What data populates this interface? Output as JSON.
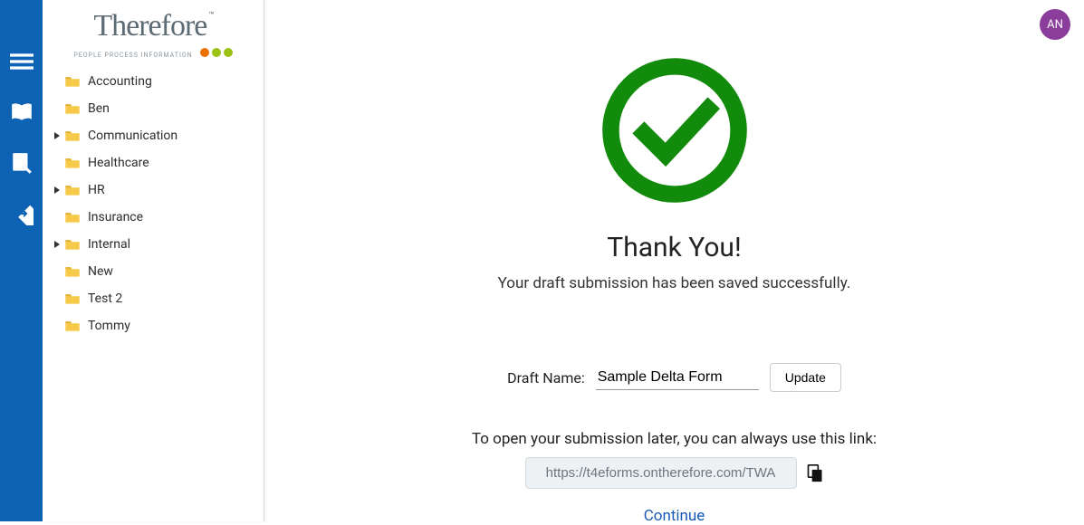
{
  "avatar_initials": "AN",
  "logo": {
    "text": "Therefore",
    "tagline": "PEOPLE  PROCESS  INFORMATION"
  },
  "sidebar": {
    "items": [
      {
        "label": "Accounting",
        "expandable": false
      },
      {
        "label": "Ben",
        "expandable": false
      },
      {
        "label": "Communication",
        "expandable": true
      },
      {
        "label": "Healthcare",
        "expandable": false
      },
      {
        "label": "HR",
        "expandable": true
      },
      {
        "label": "Insurance",
        "expandable": false
      },
      {
        "label": "Internal",
        "expandable": true
      },
      {
        "label": "New",
        "expandable": false
      },
      {
        "label": "Test 2",
        "expandable": false
      },
      {
        "label": "Tommy",
        "expandable": false
      }
    ]
  },
  "main": {
    "title": "Thank You!",
    "subtitle": "Your draft submission has been saved successfully.",
    "draft_label": "Draft Name:",
    "draft_value": "Sample Delta Form",
    "update_label": "Update",
    "link_hint": "To open your submission later, you can always use this link:",
    "link_value": "https://t4eforms.ontherefore.com/TWA",
    "continue_label": "Continue"
  }
}
